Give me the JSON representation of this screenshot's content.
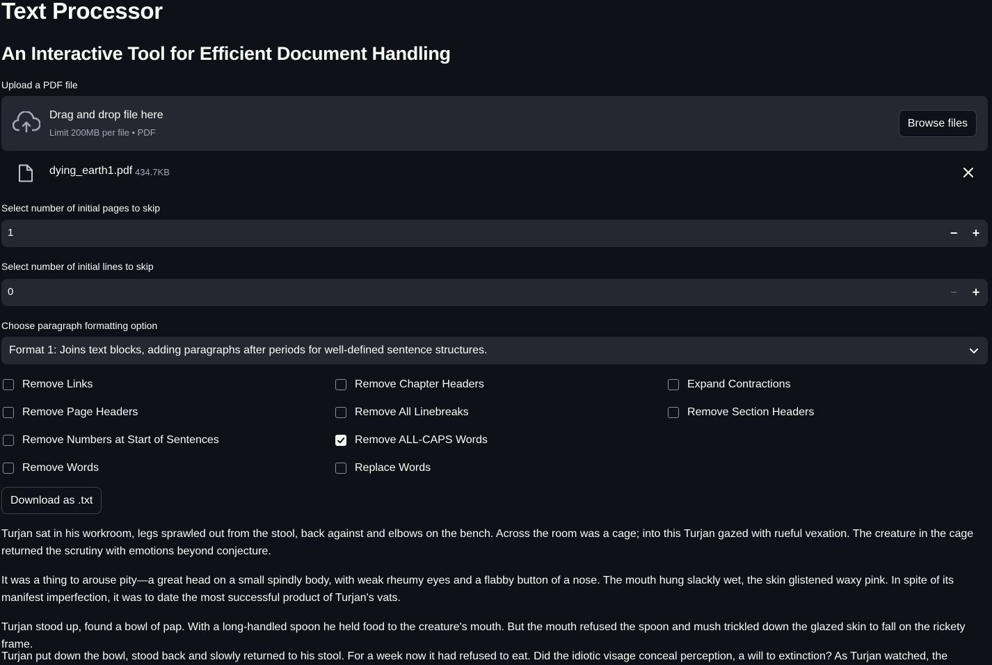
{
  "header": {
    "title": "Text Processor",
    "subtitle": "An Interactive Tool for Efficient Document Handling"
  },
  "uploader": {
    "label": "Upload a PDF file",
    "drop_text": "Drag and drop file here",
    "limit_text": "Limit 200MB per file • PDF",
    "browse_label": "Browse files",
    "icon": "cloud-upload-icon"
  },
  "uploaded_file": {
    "name": "dying_earth1.pdf",
    "size": "434.7KB",
    "icon": "file-icon"
  },
  "skip_pages": {
    "label": "Select number of initial pages to skip",
    "value": "1",
    "minus": "−",
    "plus": "+"
  },
  "skip_lines": {
    "label": "Select number of initial lines to skip",
    "value": "0",
    "minus": "−",
    "plus": "+"
  },
  "formatting": {
    "label": "Choose paragraph formatting option",
    "selected": "Format 1: Joins text blocks, adding paragraphs after periods for well-defined sentence structures."
  },
  "options": [
    {
      "label": "Remove Links",
      "checked": false
    },
    {
      "label": "Remove Chapter Headers",
      "checked": false
    },
    {
      "label": "Expand Contractions",
      "checked": false
    },
    {
      "label": "Remove Page Headers",
      "checked": false
    },
    {
      "label": "Remove All Linebreaks",
      "checked": false
    },
    {
      "label": "Remove Section Headers",
      "checked": false
    },
    {
      "label": "Remove Numbers at Start of Sentences",
      "checked": false
    },
    {
      "label": "Remove ALL-CAPS Words",
      "checked": true
    },
    {
      "label": "Remove Words",
      "checked": false
    },
    {
      "label": "Replace Words",
      "checked": false
    }
  ],
  "download_label": "Download as .txt",
  "output_paragraphs": [
    "Turjan sat in his workroom, legs sprawled out from the stool, back against and elbows on the bench. Across the room was a cage; into this Turjan gazed with rueful vexation. The creature in the cage returned the scrutiny with emotions beyond conjecture.",
    "It was a thing to arouse pity—a great head on a small spindly body, with weak rheumy eyes and a flabby button of a nose. The mouth hung slackly wet, the skin glistened waxy pink. In spite of its manifest imperfection, it was to date the most successful product of Turjan's vats.",
    "Turjan stood up, found a bowl of pap. With a long-handled spoon he held food to the creature's mouth. But the mouth refused the spoon and mush trickled down the glazed skin to fall on the rickety frame.",
    "Turjan put down the bowl, stood back and slowly returned to his stool. For a week now it had refused to eat. Did the idiotic visage conceal perception, a will to extinction? As Turjan watched, the white-blue eyes"
  ]
}
